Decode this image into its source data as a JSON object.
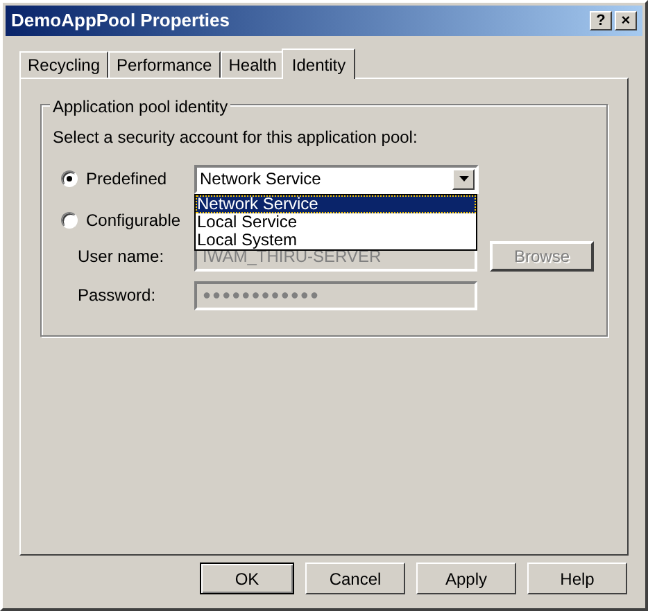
{
  "window": {
    "title": "DemoAppPool Properties",
    "title_buttons": [
      "?",
      "×"
    ]
  },
  "tabs": [
    {
      "label": "Recycling",
      "selected": false
    },
    {
      "label": "Performance",
      "selected": false
    },
    {
      "label": "Health",
      "selected": false
    },
    {
      "label": "Identity",
      "selected": true
    }
  ],
  "group": {
    "title": "Application pool identity",
    "prompt": "Select a security account for this application pool:",
    "predefined": {
      "label": "Predefined",
      "selected": true,
      "value": "Network Service",
      "expanded": true,
      "options": [
        {
          "label": "Network Service",
          "selected": true
        },
        {
          "label": "Local Service",
          "selected": false
        },
        {
          "label": "Local System",
          "selected": false
        }
      ]
    },
    "configurable": {
      "label": "Configurable",
      "selected": false,
      "user_label": "User name:",
      "user_value": "IWAM_THIRU-SERVER",
      "password_label": "Password:",
      "password_value": "●●●●●●●●●●●●",
      "browse": "Browse",
      "disabled": true
    }
  },
  "buttons": [
    {
      "label": "OK",
      "default": true
    },
    {
      "label": "Cancel",
      "default": false
    },
    {
      "label": "Apply",
      "default": false
    },
    {
      "label": "Help",
      "default": false
    }
  ]
}
